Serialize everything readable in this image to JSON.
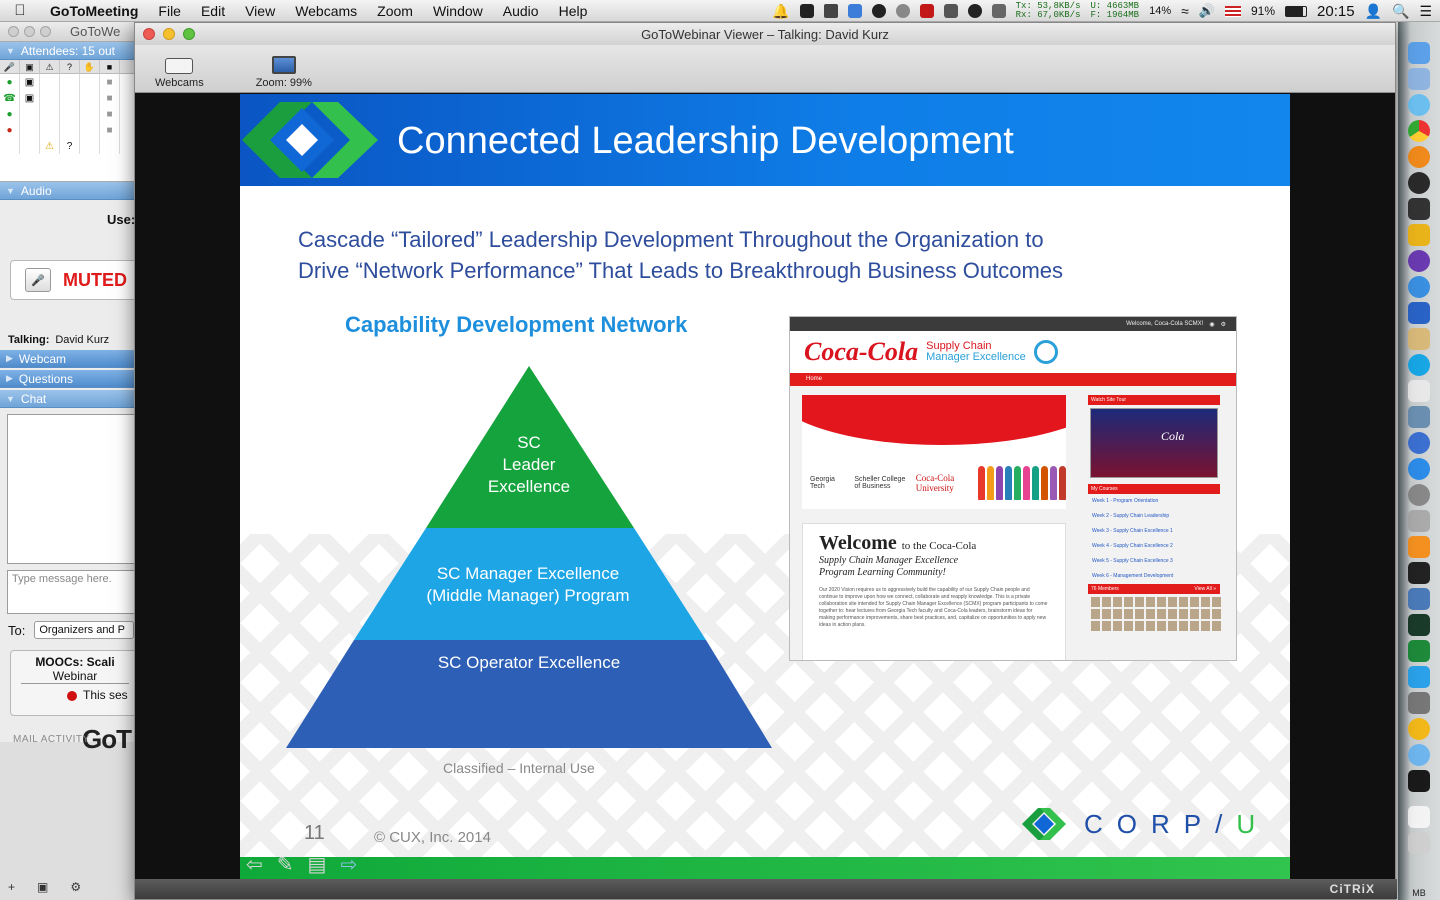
{
  "menubar": {
    "app_name": "GoToMeeting",
    "items": [
      "File",
      "Edit",
      "View",
      "Webcams",
      "Zoom",
      "Window",
      "Audio",
      "Help"
    ],
    "net_tx": "Tx: 53,8KB/s",
    "net_rx": "Rx: 67,0KB/s",
    "mem_u": "U: 4663MB",
    "mem_f": "F: 1964MB",
    "cpu": "14%",
    "battery": "91%",
    "clock": "20:15"
  },
  "panel": {
    "window_title": "GoToWe",
    "attendees_header": "Attendees: 15 out",
    "audio_header": "Audio",
    "use_label": "Use:",
    "muted_label": "MUTED",
    "talking_label": "Talking:",
    "talking_name": "David Kurz",
    "webcam_header": "Webcam",
    "questions_header": "Questions",
    "chat_header": "Chat",
    "chat_placeholder": "Type message here.",
    "to_label": "To:",
    "to_value": "Organizers and P",
    "session_title": "MOOCs: Scali",
    "session_sub": "Webinar",
    "session_status": "This ses",
    "brand": "GoT",
    "mail_activity": "MAIL ACTIVITY"
  },
  "viewer": {
    "window_title": "GoToWebinar Viewer – Talking: David Kurz",
    "webcams_label": "Webcams",
    "zoom_label": "Zoom: 99%",
    "status_brand": "CiTRiX"
  },
  "slide": {
    "title": "Connected Leadership Development",
    "subtitle_line1": "Cascade “Tailored” Leadership Development Throughout the Organization to",
    "subtitle_line2": "Drive “Network Performance” That Leads to Breakthrough Business Outcomes",
    "network_title": "Capability Development Network",
    "tier_top_1": "SC",
    "tier_top_2": "Leader",
    "tier_top_3": "Excellence",
    "tier_mid_1": "SC Manager Excellence",
    "tier_mid_2": "(Middle Manager) Program",
    "tier_bottom": "SC Operator Excellence",
    "classification": "Classified – Internal Use",
    "page_number": "11",
    "copyright": "© CUX, Inc. 2014",
    "logo_text": "CORP/",
    "logo_u": "U",
    "colors": {
      "header_blue": "#0f7ee8",
      "tier_top": "#14a33c",
      "tier_mid": "#1ea5e6",
      "tier_bottom": "#2d5fb6",
      "footer_green": "#1db43f"
    }
  },
  "screenshot": {
    "topbar_text": "Welcome, Coca-Cola SCMX!",
    "brand_cc": "Coca-Cola",
    "brand_scm_1": "Supply Chain",
    "brand_scm_2": "Manager Excellence",
    "home_tab": "Home",
    "georgia": "Georgia Tech",
    "scheller": "Scheller College of Business",
    "cc_univ": "Coca-Cola University",
    "welcome_big": "Welcome",
    "welcome_small": "to the Coca-Cola",
    "welcome_line2": "Supply Chain Manager Excellence",
    "welcome_line3": "Program Learning Community!",
    "welcome_body": "Our 2020 Vision requires us to aggressively build the capability of our Supply Chain people and continue to improve upon how we connect, collaborate and reapply knowledge. This is a private collaboration site intended for Supply Chain Manager Excellence (SCMX) program participants to come together to: hear lectures from Georgia Tech faculty and Coca-Cola leaders, brainstorm ideas for making performance improvements, share best practices, and, capitalize on opportunities to apply new ideas in action plans.",
    "watch_tour": "Watch Site Tour",
    "video_text": "Cola",
    "my_courses": "My Courses",
    "courses": [
      "Week 1 - Program Orientation",
      "Week 2 - Supply Chain Leadership",
      "Week 3 - Supply Chain Excellence 1",
      "Week 4 - Supply Chain Excellence 2",
      "Week 5 - Supply Chain Excellence 3",
      "Week 6 - Management Development"
    ],
    "members": "76 Members",
    "view_all": "View All »"
  },
  "dock": {
    "label": "MB"
  }
}
